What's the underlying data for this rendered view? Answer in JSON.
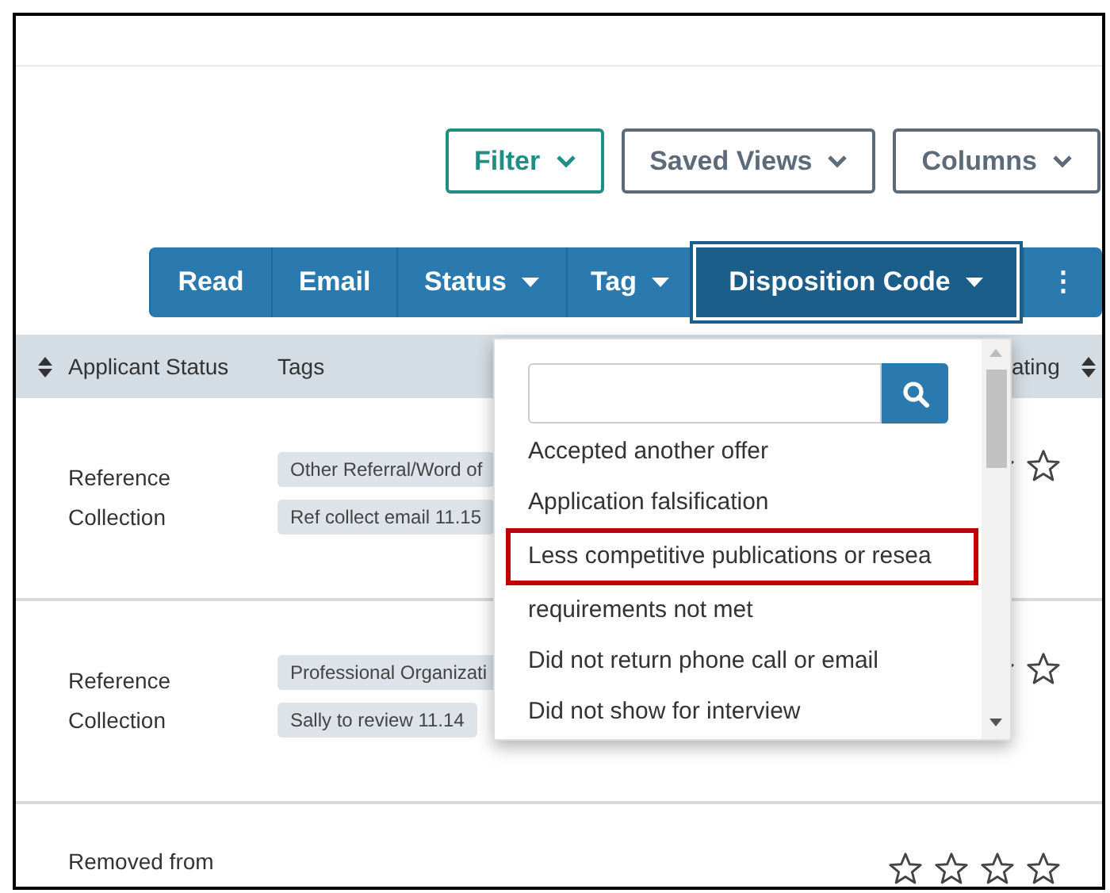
{
  "toolbar": {
    "buttons": [
      {
        "label": "Filter",
        "kind": "primary"
      },
      {
        "label": "Saved Views",
        "kind": "secondary"
      },
      {
        "label": "Columns",
        "kind": "secondary"
      }
    ]
  },
  "actions": [
    {
      "label": "Read",
      "kind": "text",
      "selected": false
    },
    {
      "label": "Email",
      "kind": "text",
      "selected": false
    },
    {
      "label": "Status",
      "kind": "menu",
      "selected": false
    },
    {
      "label": "Tag",
      "kind": "menu",
      "selected": false
    },
    {
      "label": "Disposition Code",
      "kind": "menu",
      "selected": true
    },
    {
      "label": "⋮",
      "kind": "more",
      "selected": false
    }
  ],
  "table": {
    "columns": [
      {
        "label": "Applicant Status",
        "sortable": true
      },
      {
        "label": "Tags",
        "sortable": false
      },
      {
        "label": "ating",
        "sortable": true
      }
    ],
    "rows": [
      {
        "status": "Reference Collection",
        "tags": [
          {
            "label": "Other Referral/Word of"
          },
          {
            "label": "Ref collect email 11.15"
          }
        ]
      },
      {
        "status": "Reference Collection",
        "tags": [
          {
            "label": "Professional Organizati"
          },
          {
            "label": "Sally to review 11.14"
          }
        ]
      },
      {
        "status": "Removed from",
        "tags": [],
        "stars": 0
      }
    ]
  },
  "dropdown": {
    "items": [
      {
        "label": "Accepted another offer",
        "highlighted": false
      },
      {
        "label": "Application falsification",
        "highlighted": false
      },
      {
        "label": "Less competitive publications or resea",
        "highlighted": true
      },
      {
        "label": "requirements not met",
        "highlighted": false
      },
      {
        "label": "Did not return phone call or email",
        "highlighted": false
      },
      {
        "label": "Did not show for interview",
        "highlighted": false
      }
    ]
  }
}
